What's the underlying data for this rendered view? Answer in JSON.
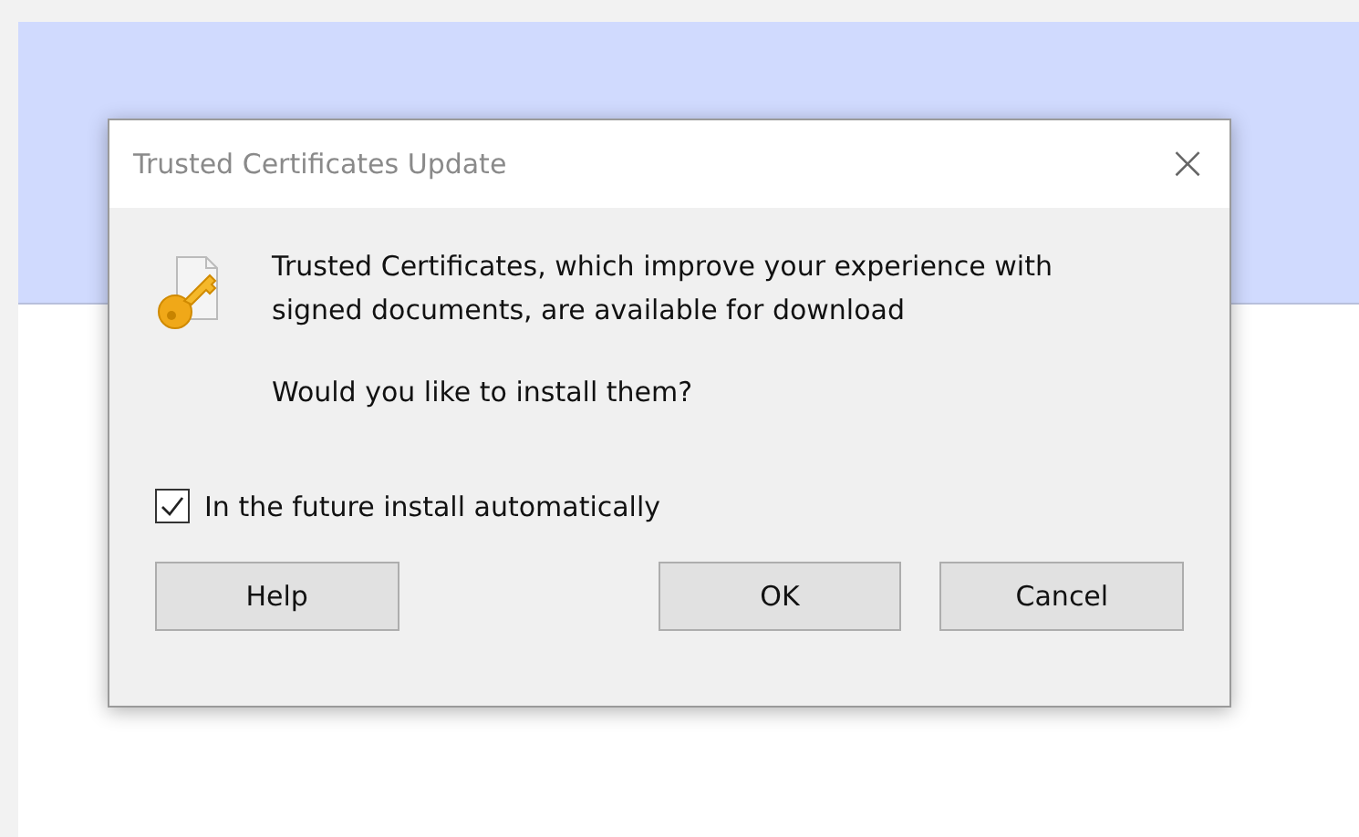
{
  "dialog": {
    "title": "Trusted Certificates Update",
    "close": "×",
    "message": "Trusted Certificates, which improve your experience with signed documents, are available for download",
    "question": "Would you like to install them?",
    "checkbox": {
      "label": "In the future install automatically",
      "checked": true
    },
    "buttons": [
      "Help",
      "OK",
      "Cancel"
    ]
  }
}
